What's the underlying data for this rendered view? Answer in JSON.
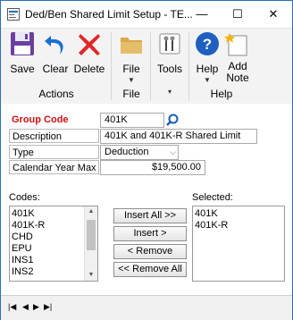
{
  "window": {
    "title": "Ded/Ben Shared Limit Setup  -  TE...",
    "minimize": "—",
    "maximize": "☐",
    "close": "✕"
  },
  "ribbon": {
    "save": "Save",
    "clear": "Clear",
    "delete": "Delete",
    "file": "File",
    "tools": "Tools",
    "help": "Help",
    "add_note": "Add\nNote",
    "group_actions": "Actions",
    "group_file": "File",
    "group_help": "Help"
  },
  "form": {
    "group_code_label": "Group Code",
    "group_code_value": "401K",
    "description_label": "Description",
    "description_value": "401K and 401K-R Shared Limit",
    "type_label": "Type",
    "type_value": "Deduction",
    "cym_label": "Calendar Year Max",
    "cym_value": "$19,500.00"
  },
  "codes": {
    "label": "Codes:",
    "items": [
      "401K",
      "401K-R",
      "CHD",
      "EPU",
      "INS1",
      "INS2"
    ]
  },
  "selected": {
    "label": "Selected:",
    "items": [
      "401K",
      "401K-R"
    ]
  },
  "buttons": {
    "insert_all": "Insert All >>",
    "insert": "Insert >",
    "remove": "< Remove",
    "remove_all": "<< Remove All"
  },
  "nav": {
    "first": "|◀",
    "prev": "◀",
    "next": "▶",
    "last": "▶|"
  },
  "colors": {
    "accent": "#2b6fb6",
    "required_label": "#d01010"
  }
}
